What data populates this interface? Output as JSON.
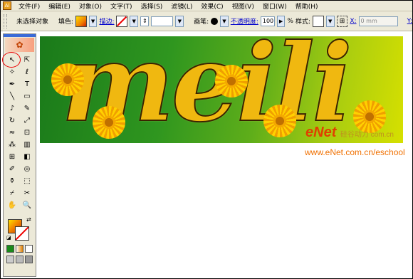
{
  "menu": {
    "app_icon": "Ai",
    "items": [
      "文件(F)",
      "编辑(E)",
      "对象(O)",
      "文字(T)",
      "选择(S)",
      "滤镜(L)",
      "效果(C)",
      "视图(V)",
      "窗口(W)",
      "帮助(H)"
    ]
  },
  "control_bar": {
    "selection_status": "未选择对象",
    "fill_label": "填色:",
    "stroke_label": "描边:",
    "brush_label": "画笔:",
    "opacity_label": "不透明度:",
    "opacity_value": "100",
    "opacity_unit": "%",
    "style_label": "样式:",
    "x_label": "X:",
    "x_value": "0 mm",
    "y_label": "Y:"
  },
  "toolbox": {
    "logo_icon": "flower-logo",
    "tools": [
      {
        "name": "selection-tool",
        "glyph": "↖"
      },
      {
        "name": "direct-selection-tool",
        "glyph": "⇱"
      },
      {
        "name": "magic-wand-tool",
        "glyph": "✧"
      },
      {
        "name": "lasso-tool",
        "glyph": "ℓ"
      },
      {
        "name": "pen-tool",
        "glyph": "✒"
      },
      {
        "name": "type-tool",
        "glyph": "T"
      },
      {
        "name": "line-tool",
        "glyph": "╲"
      },
      {
        "name": "rectangle-tool",
        "glyph": "▭"
      },
      {
        "name": "paintbrush-tool",
        "glyph": "♪"
      },
      {
        "name": "pencil-tool",
        "glyph": "✎"
      },
      {
        "name": "rotate-tool",
        "glyph": "↻"
      },
      {
        "name": "scale-tool",
        "glyph": "⤢"
      },
      {
        "name": "warp-tool",
        "glyph": "≈"
      },
      {
        "name": "free-transform-tool",
        "glyph": "⊡"
      },
      {
        "name": "symbol-sprayer-tool",
        "glyph": "⁂"
      },
      {
        "name": "column-graph-tool",
        "glyph": "▥"
      },
      {
        "name": "mesh-tool",
        "glyph": "⊞"
      },
      {
        "name": "gradient-tool",
        "glyph": "◧"
      },
      {
        "name": "eyedropper-tool",
        "glyph": "✐"
      },
      {
        "name": "blend-tool",
        "glyph": "◎"
      },
      {
        "name": "live-paint-bucket-tool",
        "glyph": "⚱"
      },
      {
        "name": "live-paint-selection-tool",
        "glyph": "⬚"
      },
      {
        "name": "slice-tool",
        "glyph": "⌿"
      },
      {
        "name": "scissors-tool",
        "glyph": "✂"
      },
      {
        "name": "hand-tool",
        "glyph": "✋"
      },
      {
        "name": "zoom-tool",
        "glyph": "🔍"
      }
    ],
    "fill_color": "#f4b000",
    "stroke_color": "none"
  },
  "artwork": {
    "word": "meili",
    "watermark": "eNet",
    "watermark_sub": "硅谷动力 com.cn",
    "watermark_url": "www.eNet.com.cn/eschool",
    "bg_start": "#1a7a1a",
    "bg_end": "#d6e000",
    "text_color": "#f0b810"
  }
}
